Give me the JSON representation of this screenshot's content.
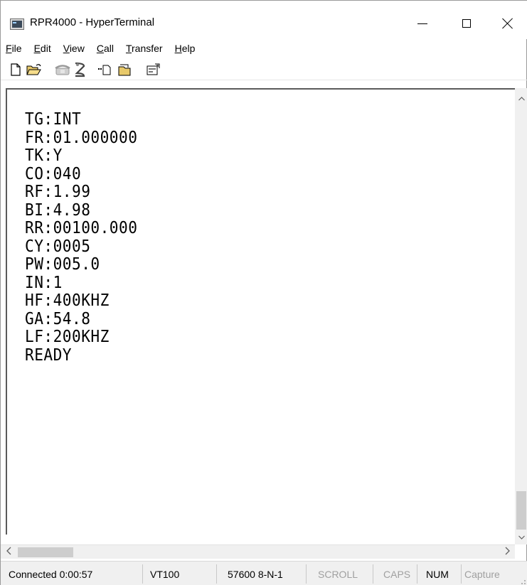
{
  "window": {
    "title": "RPR4000 - HyperTerminal",
    "icon": "hyperterminal-app-icon"
  },
  "menu": [
    {
      "label": "File",
      "mnemonic": "F",
      "rest": "ile"
    },
    {
      "label": "Edit",
      "mnemonic": "E",
      "rest": "dit"
    },
    {
      "label": "View",
      "mnemonic": "V",
      "rest": "iew"
    },
    {
      "label": "Call",
      "mnemonic": "C",
      "rest": "all"
    },
    {
      "label": "Transfer",
      "mnemonic": "T",
      "rest": "ransfer"
    },
    {
      "label": "Help",
      "mnemonic": "H",
      "rest": "elp"
    }
  ],
  "toolbar": {
    "icons": [
      "new-document-icon",
      "open-folder-icon",
      "phone-connect-icon",
      "disconnect-icon",
      "send-file-icon",
      "receive-file-icon",
      "properties-icon"
    ]
  },
  "terminal": {
    "lines": [
      "TG:INT",
      "FR:01.000000",
      "TK:Y",
      "CO:040",
      "RF:1.99",
      "BI:4.98",
      "RR:00100.000",
      "CY:0005",
      "PW:005.0",
      "IN:1",
      "HF:400KHZ",
      "GA:54.8",
      "LF:200KHZ",
      "READY"
    ]
  },
  "status": {
    "connected": "Connected 0:00:57",
    "emulation": "VT100",
    "port_settings": "57600 8-N-1",
    "scroll": "SCROLL",
    "caps": "CAPS",
    "num": "NUM",
    "capture": "Capture"
  },
  "colors": {
    "status_inactive": "#a0a0a0",
    "status_active": "#000000",
    "scroll_thumb": "#cdcdcd"
  }
}
